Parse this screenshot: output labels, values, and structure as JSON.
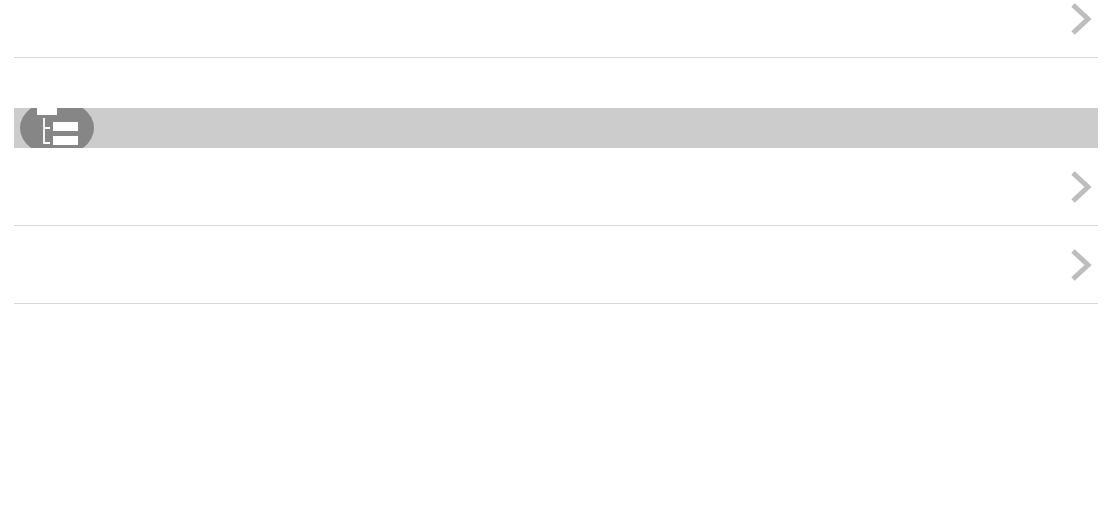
{
  "list": [
    {
      "kind": "row"
    },
    {
      "kind": "section_header"
    },
    {
      "kind": "row"
    },
    {
      "kind": "row"
    }
  ]
}
